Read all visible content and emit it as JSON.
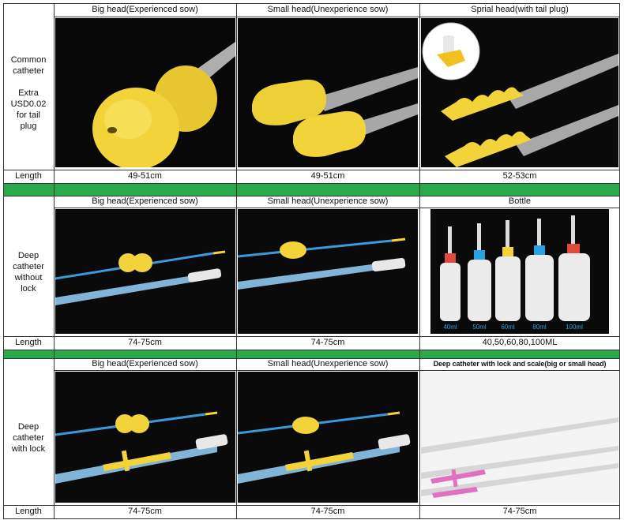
{
  "sections": [
    {
      "headers": [
        "Big head(Experienced sow)",
        "Small head(Unexperience sow)",
        "Sprial head(with tail plug)"
      ],
      "row_label": [
        "Common",
        "catheter",
        "",
        "Extra",
        "USD0.02",
        "for tail",
        "plug"
      ],
      "length_label": "Length",
      "lengths": [
        "49-51cm",
        "49-51cm",
        "52-53cm"
      ]
    },
    {
      "headers": [
        "Big head(Experienced sow)",
        "Small head(Unexperience sow)",
        "Bottle"
      ],
      "row_label": [
        "Deep",
        "catheter",
        "without",
        "lock"
      ],
      "length_label": "Length",
      "lengths": [
        "74-75cm",
        "74-75cm",
        "40,50,60,80,100ML"
      ],
      "bottle_sizes": [
        "40ml",
        "50ml",
        "60ml",
        "80ml",
        "100ml"
      ]
    },
    {
      "headers": [
        "Big head(Experienced sow)",
        "Small head(Unexperience sow)",
        "Deep catheter with lock and scale(big or small head)"
      ],
      "row_label": [
        "Deep",
        "catheter",
        "with lock"
      ],
      "length_label": "Length",
      "lengths": [
        "74-75cm",
        "74-75cm",
        "74-75cm"
      ]
    }
  ],
  "colors": {
    "divider_green": "#2aa84a",
    "foam_yellow": "#f2d43a",
    "catheter_blue": "#3a9ad9",
    "lock_pink": "#e070c0"
  }
}
